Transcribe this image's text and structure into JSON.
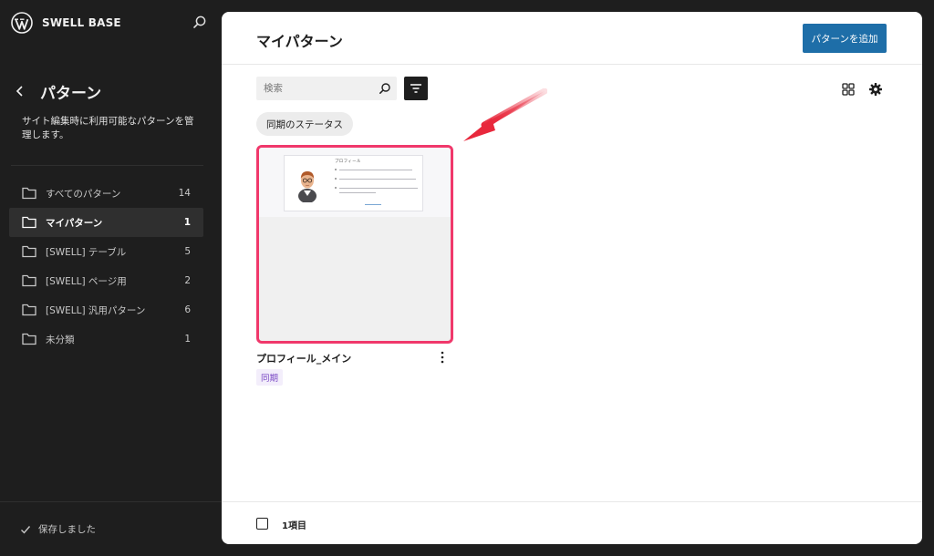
{
  "site": {
    "title": "SWELL BASE"
  },
  "sidebar": {
    "title": "パターン",
    "description": "サイト編集時に利用可能なパターンを管理します。",
    "items": [
      {
        "label": "すべてのパターン",
        "count": "14"
      },
      {
        "label": "マイパターン",
        "count": "1",
        "active": true
      },
      {
        "label": "[SWELL] テーブル",
        "count": "5"
      },
      {
        "label": "[SWELL] ページ用",
        "count": "2"
      },
      {
        "label": "[SWELL] 汎用パターン",
        "count": "6"
      },
      {
        "label": "未分類",
        "count": "1"
      }
    ],
    "save_status": "保存しました"
  },
  "main": {
    "title": "マイパターン",
    "add_button": "パターンを追加",
    "search": {
      "placeholder": "検索",
      "value": ""
    },
    "filter_chip": "同期のステータス",
    "patterns": [
      {
        "title": "プロフィール_メイン",
        "badge": "同期",
        "preview_heading": "プロフィール"
      }
    ],
    "footer": {
      "count_label": "1項目"
    }
  },
  "colors": {
    "sidebar_bg": "#1e1e1e",
    "accent": "#1e6ea8",
    "highlight_border": "#f0386b",
    "annotation_arrow": "#e8283c",
    "sync_badge": "#7a48c4"
  },
  "icons": {
    "logo": "wordpress-logo",
    "hub_search": "search-icon",
    "back": "chevron-left-icon",
    "nav_item": "folder-icon",
    "filter": "filter-icon",
    "view": "grid-view-icon",
    "settings": "gear-icon",
    "card_menu": "more-vertical-icon",
    "saved": "check-icon"
  }
}
